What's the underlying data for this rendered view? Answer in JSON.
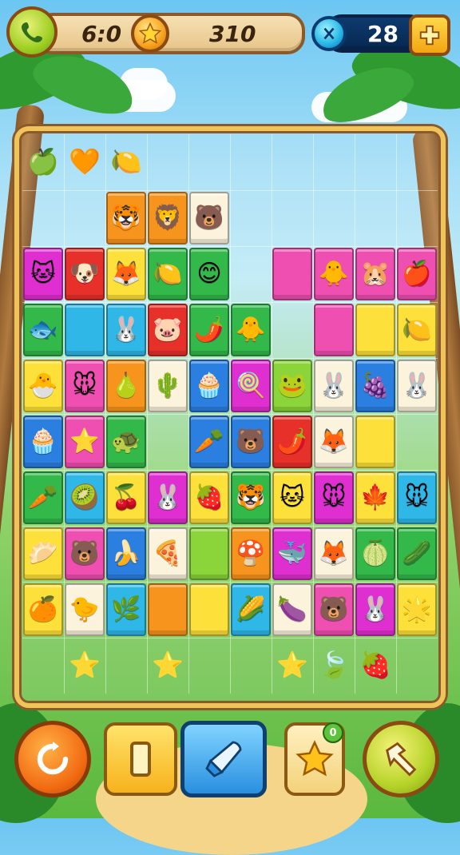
{
  "hud": {
    "moves": "6:0",
    "score": "310",
    "gems": "28",
    "left_icon": "phone-icon",
    "star_icon": "star-icon",
    "gem_icon": "gem-icon",
    "add_icon": "plus-icon"
  },
  "colors": {
    "red": "#e8302a",
    "orange": "#f7941d",
    "yellow": "#fde13a",
    "lime": "#8bd43a",
    "green": "#33b84a",
    "cyan": "#2fb7e8",
    "blue": "#2a7fe0",
    "pink": "#ef4fb0",
    "magenta": "#e02fd0",
    "purple": "#9b4de0",
    "cream": "#fbf3dc",
    "empty": "transparent"
  },
  "board": {
    "cols": 10,
    "rows": 10,
    "cells": [
      [
        [
          "empty",
          "🍏"
        ],
        [
          "empty",
          "🧡"
        ],
        [
          "empty",
          "🍋"
        ],
        [
          "empty",
          ""
        ],
        [
          "empty",
          ""
        ],
        [
          "empty",
          ""
        ],
        [
          "empty",
          ""
        ],
        [
          "empty",
          ""
        ],
        [
          "empty",
          ""
        ],
        [
          "empty",
          ""
        ]
      ],
      [
        [
          "empty",
          ""
        ],
        [
          "empty",
          ""
        ],
        [
          "orange",
          "🐯"
        ],
        [
          "orange",
          "🦁"
        ],
        [
          "cream",
          "🐻"
        ],
        [
          "empty",
          ""
        ],
        [
          "empty",
          ""
        ],
        [
          "empty",
          ""
        ],
        [
          "empty",
          ""
        ],
        [
          "empty",
          ""
        ]
      ],
      [
        [
          "magenta",
          "🐱"
        ],
        [
          "red",
          "🐶"
        ],
        [
          "yellow",
          "🦊"
        ],
        [
          "green",
          "🍋"
        ],
        [
          "green",
          "😊"
        ],
        [
          "empty",
          ""
        ],
        [
          "pink",
          ""
        ],
        [
          "pink",
          "🐥"
        ],
        [
          "pink",
          "🐹"
        ],
        [
          "pink",
          "🍎"
        ]
      ],
      [
        [
          "green",
          "🐟"
        ],
        [
          "cyan",
          ""
        ],
        [
          "cyan",
          "🐰"
        ],
        [
          "red",
          "🐷"
        ],
        [
          "green",
          "🌶️"
        ],
        [
          "green",
          "🐥"
        ],
        [
          "empty",
          ""
        ],
        [
          "pink",
          ""
        ],
        [
          "yellow",
          ""
        ],
        [
          "yellow",
          "🍋"
        ]
      ],
      [
        [
          "yellow",
          "🐣"
        ],
        [
          "pink",
          "🐭"
        ],
        [
          "orange",
          "🍐"
        ],
        [
          "cream",
          "🌵"
        ],
        [
          "blue",
          "🧁"
        ],
        [
          "magenta",
          "🍭"
        ],
        [
          "lime",
          "🐸"
        ],
        [
          "cream",
          "🐰"
        ],
        [
          "blue",
          "🍇"
        ],
        [
          "cream",
          "🐰"
        ]
      ],
      [
        [
          "blue",
          "🧁"
        ],
        [
          "pink",
          "⭐"
        ],
        [
          "green",
          "🐢"
        ],
        [
          "empty",
          ""
        ],
        [
          "blue",
          "🥕"
        ],
        [
          "blue",
          "🐻"
        ],
        [
          "red",
          "🌶️"
        ],
        [
          "cream",
          "🦊"
        ],
        [
          "yellow",
          ""
        ],
        [
          "empty",
          ""
        ]
      ],
      [
        [
          "green",
          "🥕"
        ],
        [
          "cyan",
          "🥝"
        ],
        [
          "yellow",
          "🍒"
        ],
        [
          "magenta",
          "🐰"
        ],
        [
          "yellow",
          "🍓"
        ],
        [
          "green",
          "🐯"
        ],
        [
          "yellow",
          "🐱"
        ],
        [
          "magenta",
          "🐭"
        ],
        [
          "yellow",
          "🍁"
        ],
        [
          "cyan",
          "🐭"
        ]
      ],
      [
        [
          "yellow",
          "🥟"
        ],
        [
          "pink",
          "🐻"
        ],
        [
          "blue",
          "🍌"
        ],
        [
          "cream",
          "🍕"
        ],
        [
          "lime",
          ""
        ],
        [
          "orange",
          "🍄"
        ],
        [
          "magenta",
          "🐳"
        ],
        [
          "cream",
          "🦊"
        ],
        [
          "green",
          "🍈"
        ],
        [
          "green",
          "🥒"
        ]
      ],
      [
        [
          "yellow",
          "🍊"
        ],
        [
          "cream",
          "🐤"
        ],
        [
          "cyan",
          "🌿"
        ],
        [
          "orange",
          ""
        ],
        [
          "yellow",
          ""
        ],
        [
          "cyan",
          "🌽"
        ],
        [
          "cream",
          "🍆"
        ],
        [
          "pink",
          "🐻"
        ],
        [
          "magenta",
          "🐰"
        ],
        [
          "yellow",
          "🌟"
        ]
      ],
      [
        [
          "empty",
          ""
        ],
        [
          "empty",
          "⭐"
        ],
        [
          "empty",
          ""
        ],
        [
          "empty",
          "⭐"
        ],
        [
          "empty",
          ""
        ],
        [
          "empty",
          ""
        ],
        [
          "empty",
          "⭐"
        ],
        [
          "empty",
          "🍃"
        ],
        [
          "empty",
          "🍓"
        ],
        [
          "empty",
          ""
        ]
      ]
    ]
  },
  "bottom": {
    "restart_icon": "restart-icon",
    "pause_icon": "pause-icon",
    "rocket_icon": "rocket-booster-icon",
    "star_booster_icon": "star-booster-icon",
    "hammer_icon": "hammer-icon",
    "booster_count": "0"
  }
}
